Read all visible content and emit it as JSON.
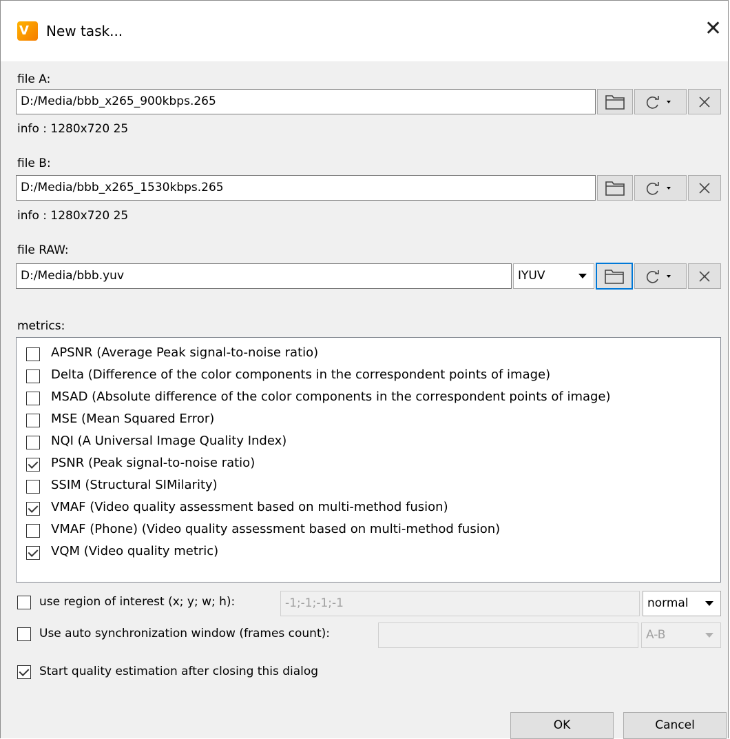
{
  "window": {
    "title": "New task...",
    "close_symbol": "✕",
    "app_icon_text": "V"
  },
  "file_a": {
    "label": "file A:",
    "path": "D:/Media/bbb_x265_900kbps.265",
    "info": "info : 1280x720 25"
  },
  "file_b": {
    "label": "file B:",
    "path": "D:/Media/bbb_x265_1530kbps.265",
    "info": "info : 1280x720 25"
  },
  "file_raw": {
    "label": "file RAW:",
    "path": "D:/Media/bbb.yuv",
    "format": "IYUV"
  },
  "metrics": {
    "label": "metrics:",
    "items": [
      {
        "label": "APSNR (Average Peak signal-to-noise ratio)",
        "checked": false
      },
      {
        "label": "Delta (Difference of the color components in the correspondent points of image)",
        "checked": false
      },
      {
        "label": "MSAD (Absolute difference of the color components in the correspondent points of image)",
        "checked": false
      },
      {
        "label": "MSE (Mean Squared Error)",
        "checked": false
      },
      {
        "label": "NQI (A Universal Image Quality Index)",
        "checked": false
      },
      {
        "label": "PSNR (Peak signal-to-noise ratio)",
        "checked": true
      },
      {
        "label": "SSIM (Structural SIMilarity)",
        "checked": false
      },
      {
        "label": "VMAF (Video quality assessment based on multi-method fusion)",
        "checked": true
      },
      {
        "label": "VMAF (Phone) (Video quality assessment based on multi-method fusion)",
        "checked": false
      },
      {
        "label": "VQM (Video quality metric)",
        "checked": true
      }
    ]
  },
  "roi": {
    "label": "use region of interest  (x; y; w; h):",
    "checked": false,
    "value": "-1;-1;-1;-1",
    "mode": "normal"
  },
  "sync": {
    "label": "Use auto synchronization window (frames count):",
    "checked": false,
    "value": "",
    "mode": "A-B"
  },
  "start_after": {
    "label": "Start quality estimation after closing this dialog",
    "checked": true
  },
  "buttons": {
    "ok": "OK",
    "cancel": "Cancel"
  },
  "icons": {
    "browse": "folder-icon",
    "reload": "reload-icon",
    "clear": "close-icon",
    "dropdown": "chevron-down-icon"
  },
  "colors": {
    "focus": "#0078d7",
    "brand": "#f57c00"
  }
}
